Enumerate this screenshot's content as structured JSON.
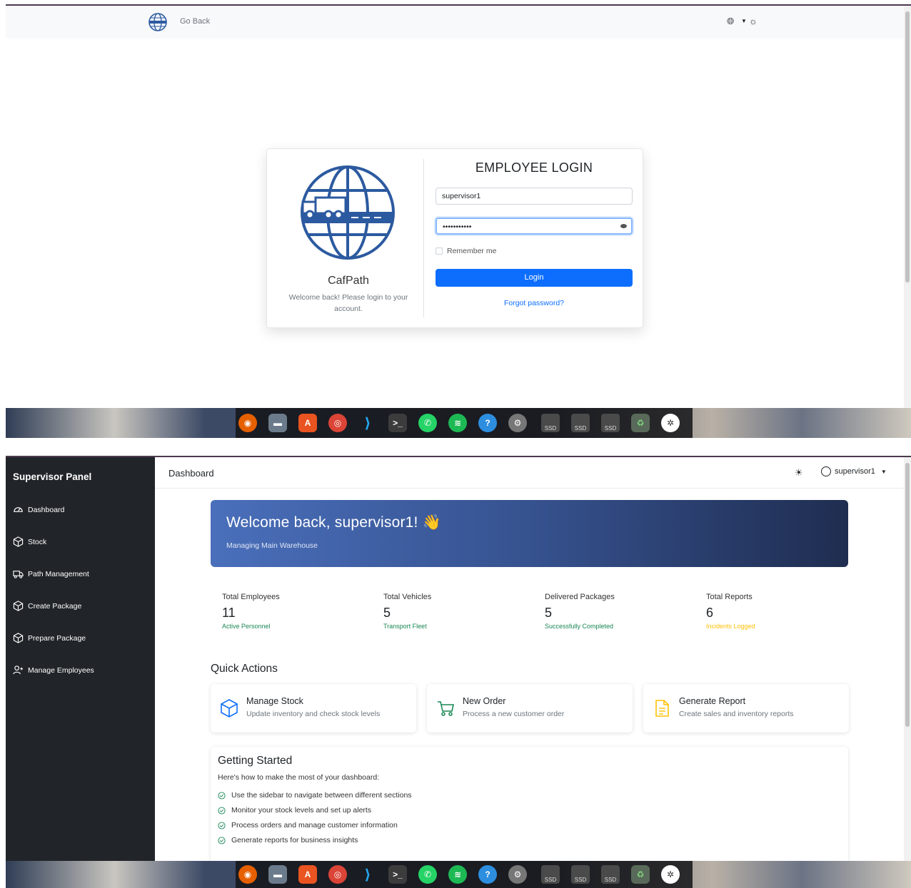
{
  "login_screen": {
    "navbar": {
      "go_back": "Go Back",
      "language_icon": "globe-icon",
      "theme_icon": "sun-icon"
    },
    "brand": {
      "name": "CafPath",
      "welcome": "Welcome back! Please login to your account."
    },
    "form": {
      "title": "EMPLOYEE LOGIN",
      "username_value": "supervisor1",
      "password_value": "•••••••••••",
      "remember_label": "Remember me",
      "login_button": "Login",
      "forgot_link": "Forgot password?"
    }
  },
  "dashboard_screen": {
    "sidebar": {
      "title": "Supervisor Panel",
      "items": [
        {
          "label": "Dashboard",
          "icon": "speedometer-icon"
        },
        {
          "label": "Stock",
          "icon": "box-icon"
        },
        {
          "label": "Path Management",
          "icon": "truck-icon"
        },
        {
          "label": "Create Package",
          "icon": "box-icon"
        },
        {
          "label": "Prepare Package",
          "icon": "box-icon"
        },
        {
          "label": "Manage Employees",
          "icon": "person-add-icon"
        }
      ]
    },
    "header": {
      "title": "Dashboard",
      "user": "supervisor1"
    },
    "banner": {
      "heading": "Welcome back, supervisor1! 👋",
      "subtitle": "Managing Main Warehouse"
    },
    "stats": [
      {
        "label": "Total Employees",
        "value": "11",
        "sub": "Active Personnel",
        "color": "#198754"
      },
      {
        "label": "Total Vehicles",
        "value": "5",
        "sub": "Transport Fleet",
        "color": "#198754"
      },
      {
        "label": "Delivered Packages",
        "value": "5",
        "sub": "Successfully Completed",
        "color": "#198754"
      },
      {
        "label": "Total Reports",
        "value": "6",
        "sub": "Incidents Logged",
        "color": "#ffc107"
      }
    ],
    "quick_actions": {
      "title": "Quick Actions",
      "cards": [
        {
          "title": "Manage Stock",
          "desc": "Update inventory and check stock levels",
          "icon": "box-icon"
        },
        {
          "title": "New Order",
          "desc": "Process a new customer order",
          "icon": "cart-icon"
        },
        {
          "title": "Generate Report",
          "desc": "Create sales and inventory reports",
          "icon": "document-icon"
        }
      ]
    },
    "getting_started": {
      "title": "Getting Started",
      "desc": "Here's how to make the most of your dashboard:",
      "items": [
        "Use the sidebar to navigate between different sections",
        "Monitor your stock levels and set up alerts",
        "Process orders and manage customer information",
        "Generate reports for business insights"
      ]
    }
  },
  "dock": {
    "apps": [
      "firefox-icon",
      "files-icon",
      "app-center-icon",
      "chrome-icon",
      "vscode-icon",
      "terminal-icon",
      "whatsapp-icon",
      "spotify-icon",
      "help-icon",
      "settings-icon",
      "ssd-drive-icon",
      "ssd-drive-icon",
      "ssd-drive-icon",
      "trash-icon",
      "ubuntu-icon"
    ],
    "ssd_label": "SSD"
  },
  "colors": {
    "primary": "#0d6efd",
    "sidebar_bg": "#212529",
    "banner_start": "#4a6fbb",
    "banner_end": "#1f2d50",
    "success": "#198754",
    "warning": "#ffc107"
  }
}
